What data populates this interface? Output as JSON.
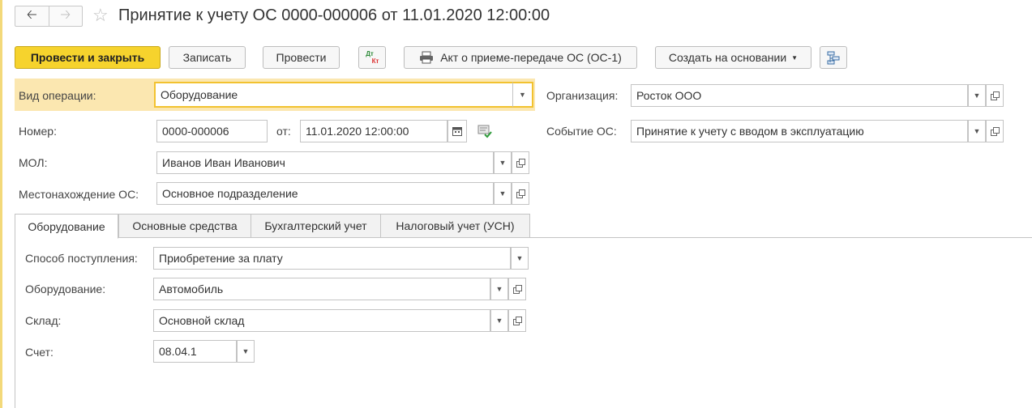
{
  "header": {
    "back_icon": "arrow-left-icon",
    "forward_icon": "arrow-right-icon",
    "title": "Принятие к учету ОС 0000-000006 от 11.01.2020 12:00:00"
  },
  "toolbar": {
    "post_close": "Провести и закрыть",
    "save": "Записать",
    "post": "Провести",
    "dtkt_top": "Дт",
    "dtkt_bottom": "Кт",
    "print_act": "Акт о приеме-передаче ОС (ОС-1)",
    "create_based": "Создать на основании"
  },
  "form": {
    "operation_label": "Вид операции:",
    "operation_value": "Оборудование",
    "organization_label": "Организация:",
    "organization_value": "Росток ООО",
    "number_label": "Номер:",
    "number_value": "0000-000006",
    "date_label": "от:",
    "date_value": "11.01.2020 12:00:00",
    "event_label": "Событие ОС:",
    "event_value": "Принятие к учету с вводом в эксплуатацию",
    "mol_label": "МОЛ:",
    "mol_value": "Иванов Иван Иванович",
    "location_label": "Местонахождение ОС:",
    "location_value": "Основное подразделение"
  },
  "tabs": [
    {
      "label": "Оборудование",
      "active": true
    },
    {
      "label": "Основные средства",
      "active": false
    },
    {
      "label": "Бухгалтерский учет",
      "active": false
    },
    {
      "label": "Налоговый учет (УСН)",
      "active": false
    }
  ],
  "tab_equipment": {
    "method_label": "Способ поступления:",
    "method_value": "Приобретение за плату",
    "equipment_label": "Оборудование:",
    "equipment_value": "Автомобиль",
    "warehouse_label": "Склад:",
    "warehouse_value": "Основной склад",
    "account_label": "Счет:",
    "account_value": "08.04.1"
  },
  "colors": {
    "primary_button": "#f6d32d",
    "highlight_row": "#fbe7b0",
    "focus_border": "#f2c230"
  }
}
